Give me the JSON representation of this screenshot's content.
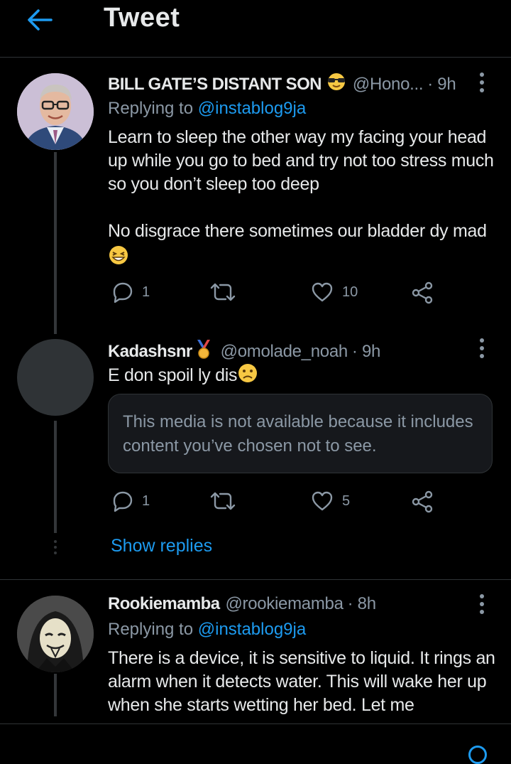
{
  "header": {
    "title": "Tweet"
  },
  "tweets": [
    {
      "name": "BILL GATE’S DISTANT SON",
      "name_emoji": "sunglasses-face",
      "handle": "@Hono...",
      "time": "· 9h",
      "replying_label": "Replying to",
      "replying_handle": "@instablog9ja",
      "text_1": "Learn to sleep the other way my facing your head up while you go to bed and try not too stress much so you don’t sleep too deep",
      "text_2": "No disgrace there sometimes our bladder dy mad",
      "text_emoji": "grinning-squinting-face",
      "replies": "1",
      "retweets": "",
      "likes": "10"
    },
    {
      "name": "Kadashsnr",
      "name_emoji": "medal",
      "handle": "@omolade_noah",
      "time": "· 9h",
      "text_1": "E don spoil ly dis",
      "text_emoji": "confused-face",
      "media_notice": "This media is not available because it includes content you’ve chosen not to see.",
      "replies": "1",
      "retweets": "",
      "likes": "5",
      "show_replies": "Show replies"
    },
    {
      "name": "Rookiemamba",
      "handle": "@rookiemamba",
      "time": "· 8h",
      "replying_label": "Replying to",
      "replying_handle": "@instablog9ja",
      "text_1": "There is a device, it is sensitive to liquid. It rings an alarm when it detects water. This will wake her up when she starts wetting her bed. Let me"
    }
  ],
  "colors": {
    "background": "#000000",
    "accent": "#1d9bf0",
    "secondary_text": "#8b98a5",
    "primary_text": "#e7e9ea"
  }
}
